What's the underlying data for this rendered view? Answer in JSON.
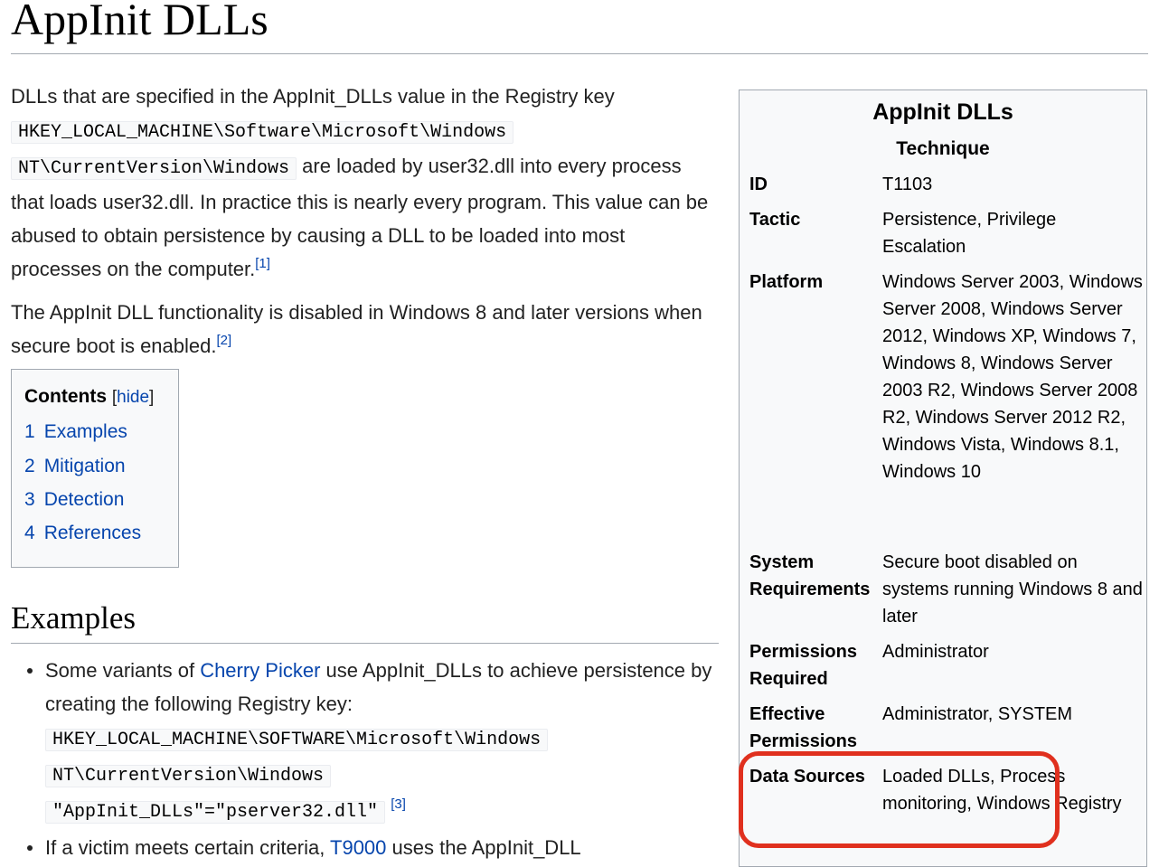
{
  "page": {
    "title": "AppInit DLLs"
  },
  "intro": {
    "p1_text1": "DLLs that are specified in the AppInit_DLLs value in the Registry key",
    "p1_code1": "HKEY_LOCAL_MACHINE\\Software\\Microsoft\\Windows",
    "p1_code2": "NT\\CurrentVersion\\Windows",
    "p1_text2": " are loaded by user32.dll into every process that loads user32.dll. In practice this is nearly every program. This value can be abused to obtain persistence by causing a DLL to be loaded into most processes on the computer.",
    "p1_ref": "[1]",
    "p2_text": "The AppInit DLL functionality is disabled in Windows 8 and later versions when secure boot is enabled.",
    "p2_ref": "[2]"
  },
  "toc": {
    "heading": "Contents",
    "hide_label": "hide",
    "items": [
      {
        "num": "1",
        "label": "Examples"
      },
      {
        "num": "2",
        "label": "Mitigation"
      },
      {
        "num": "3",
        "label": "Detection"
      },
      {
        "num": "4",
        "label": "References"
      }
    ]
  },
  "examples": {
    "heading": "Examples",
    "item1": {
      "text1": "Some variants of ",
      "link": "Cherry Picker",
      "text2": " use AppInit_DLLs to achieve persistence by creating the following Registry key:",
      "code1": "HKEY_LOCAL_MACHINE\\SOFTWARE\\Microsoft\\Windows",
      "code2": "NT\\CurrentVersion\\Windows",
      "code3": "\"AppInit_DLLs\"=\"pserver32.dll\"",
      "ref": "[3]"
    },
    "item2": {
      "text1": "If a victim meets certain criteria, ",
      "link": "T9000",
      "text2": " uses the AppInit_DLL"
    }
  },
  "infobox": {
    "title": "AppInit DLLs",
    "subtitle": "Technique",
    "rows": [
      {
        "label": "ID",
        "value": "T1103"
      },
      {
        "label": "Tactic",
        "value": "Persistence, Privilege Escalation"
      },
      {
        "label": "Platform",
        "value": "Windows Server 2003, Windows Server 2008, Windows Server 2012, Windows XP, Windows 7, Windows 8, Windows Server 2003 R2, Windows Server 2008 R2, Windows Server 2012 R2, Windows Vista, Windows 8.1, Windows 10"
      },
      {
        "label": "System Requirements",
        "value": "Secure boot disabled on systems running Windows 8 and later"
      },
      {
        "label": "Permissions Required",
        "value": "Administrator"
      },
      {
        "label": "Effective Permissions",
        "value": "Administrator, SYSTEM"
      },
      {
        "label": "Data Sources",
        "value": "Loaded DLLs, Process monitoring, Windows Registry"
      }
    ]
  },
  "colors": {
    "link": "#0645ad",
    "highlight": "#e0301e",
    "panel_bg": "#f8f9fa",
    "border": "#a2a9b1"
  }
}
